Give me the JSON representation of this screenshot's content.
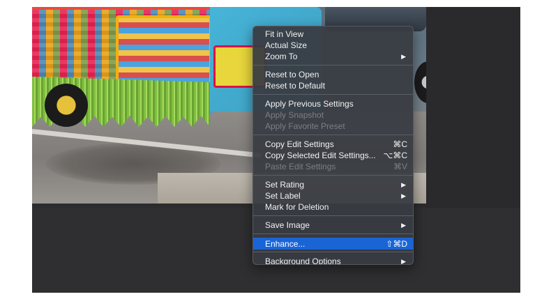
{
  "context_menu": {
    "groups": [
      {
        "items": [
          {
            "label": "Fit in View",
            "enabled": true
          },
          {
            "label": "Actual Size",
            "enabled": true
          },
          {
            "label": "Zoom To",
            "enabled": true,
            "submenu": true
          }
        ]
      },
      {
        "items": [
          {
            "label": "Reset to Open",
            "enabled": true
          },
          {
            "label": "Reset to Default",
            "enabled": true
          }
        ]
      },
      {
        "items": [
          {
            "label": "Apply Previous Settings",
            "enabled": true
          },
          {
            "label": "Apply Snapshot",
            "enabled": false
          },
          {
            "label": "Apply Favorite Preset",
            "enabled": false
          }
        ]
      },
      {
        "items": [
          {
            "label": "Copy Edit Settings",
            "enabled": true,
            "shortcut": "⌘C"
          },
          {
            "label": "Copy Selected Edit Settings...",
            "enabled": true,
            "shortcut": "⌥⌘C"
          },
          {
            "label": "Paste Edit Settings",
            "enabled": false,
            "shortcut": "⌘V"
          }
        ]
      },
      {
        "items": [
          {
            "label": "Set Rating",
            "enabled": true,
            "submenu": true
          },
          {
            "label": "Set Label",
            "enabled": true,
            "submenu": true
          },
          {
            "label": "Mark for Deletion",
            "enabled": true
          }
        ]
      },
      {
        "items": [
          {
            "label": "Save Image",
            "enabled": true,
            "submenu": true
          }
        ]
      },
      {
        "items": [
          {
            "label": "Enhance...",
            "enabled": true,
            "shortcut": "⇧⌘D",
            "highlighted": true
          }
        ]
      },
      {
        "items": [
          {
            "label": "Background Options",
            "enabled": true,
            "submenu": true
          }
        ]
      }
    ],
    "submenu_arrow": "▶"
  },
  "colors": {
    "menu_bg": "#383c42",
    "highlight": "#1a65d6",
    "text": "#f2f2f2",
    "disabled_text": "#7c7f84",
    "app_bg": "#2c2c2e"
  },
  "icons": {
    "submenu_arrow": "submenu-arrow-icon"
  }
}
